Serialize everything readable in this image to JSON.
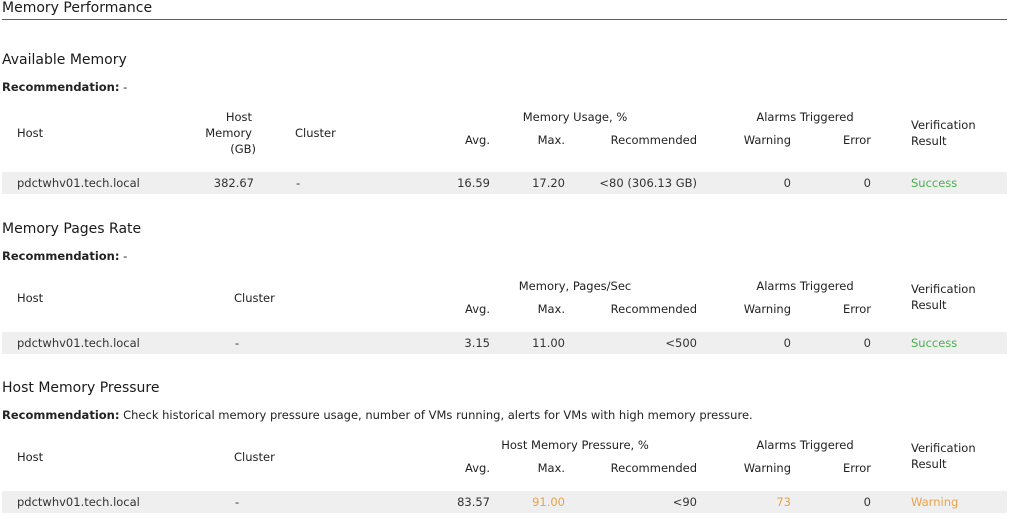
{
  "page": {
    "title": "Memory Performance"
  },
  "columns": {
    "host": "Host",
    "cluster": "Cluster",
    "avg": "Avg.",
    "max": "Max.",
    "recommended": "Recommended",
    "alarms": "Alarms Triggered",
    "warning": "Warning",
    "error": "Error",
    "verification_line1": "Verification",
    "verification_line2": "Result",
    "host_memory_line1": "Host",
    "host_memory_line2": "Memory",
    "host_memory_line3": "(GB)"
  },
  "sections": [
    {
      "title": "Available Memory",
      "recommendation_label": "Recommendation:",
      "recommendation_text": " -",
      "metric_group": "Memory Usage, %",
      "row": {
        "host": "pdctwhv01.tech.local",
        "host_memory": "382.67",
        "cluster": "-",
        "avg": "16.59",
        "max": "17.20",
        "recommended": "<80 (306.13 GB)",
        "warning": "0",
        "error": "0",
        "result": "Success"
      }
    },
    {
      "title": "Memory Pages Rate",
      "recommendation_label": "Recommendation:",
      "recommendation_text": " -",
      "metric_group": "Memory, Pages/Sec",
      "row": {
        "host": "pdctwhv01.tech.local",
        "cluster": "-",
        "avg": "3.15",
        "max": "11.00",
        "recommended": "<500",
        "warning": "0",
        "error": "0",
        "result": "Success"
      }
    },
    {
      "title": "Host Memory Pressure",
      "recommendation_label": "Recommendation:",
      "recommendation_text": " Check historical memory pressure usage, number of VMs running, alerts for VMs with high memory pressure.",
      "metric_group": "Host Memory Pressure, %",
      "row": {
        "host": "pdctwhv01.tech.local",
        "cluster": "-",
        "avg": "83.57",
        "max": "91.00",
        "recommended": "<90",
        "warning": "73",
        "error": "0",
        "result": "Warning"
      }
    }
  ],
  "colors": {
    "success": "#4caf50",
    "warning": "#e8a24a",
    "row_bg": "#efefef",
    "rule": "#2e6c8a"
  }
}
